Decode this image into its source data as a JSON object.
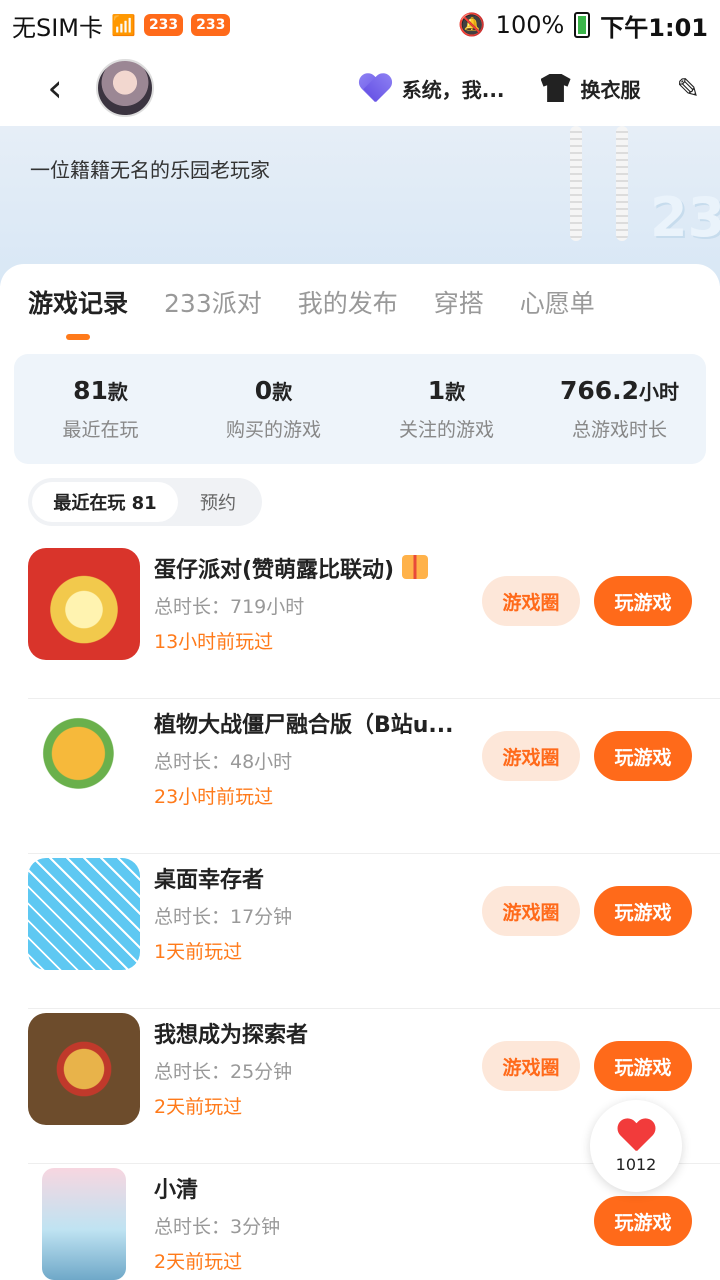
{
  "status_bar": {
    "carrier": "无SIM卡",
    "badges": [
      "233",
      "233"
    ],
    "battery": "100%",
    "time": "下午1:01"
  },
  "header": {
    "status_text": "系统，我...",
    "wardrobe_label": "换衣服"
  },
  "profile": {
    "bio": "一位籍籍无名的乐园老玩家",
    "banner_logo": "233"
  },
  "tabs": [
    "游戏记录",
    "233派对",
    "我的发布",
    "穿搭",
    "心愿单"
  ],
  "stats": [
    {
      "value": "81",
      "unit": "款",
      "label": "最近在玩"
    },
    {
      "value": "0",
      "unit": "款",
      "label": "购买的游戏"
    },
    {
      "value": "1",
      "unit": "款",
      "label": "关注的游戏"
    },
    {
      "value": "766.2",
      "unit": "小时",
      "label": "总游戏时长"
    }
  ],
  "filters": {
    "recent": "最近在玩 81",
    "reserve": "预约"
  },
  "buttons": {
    "circle": "游戏圈",
    "play": "玩游戏"
  },
  "games": [
    {
      "title": "蛋仔派对(赞萌露比联动)",
      "duration": "总时长：719小时",
      "last_played": "13小时前玩过"
    },
    {
      "title": "植物大战僵尸融合版（B站u...",
      "duration": "总时长：48小时",
      "last_played": "23小时前玩过"
    },
    {
      "title": "桌面幸存者",
      "duration": "总时长：17分钟",
      "last_played": "1天前玩过"
    },
    {
      "title": "我想成为探索者",
      "duration": "总时长：25分钟",
      "last_played": "2天前玩过"
    },
    {
      "title": "小清",
      "duration": "总时长：3分钟",
      "last_played": "2天前玩过"
    }
  ],
  "like": {
    "count": "1012"
  },
  "colors": {
    "accent": "#ff6a1a",
    "stats_bg": "#eef4fa"
  }
}
